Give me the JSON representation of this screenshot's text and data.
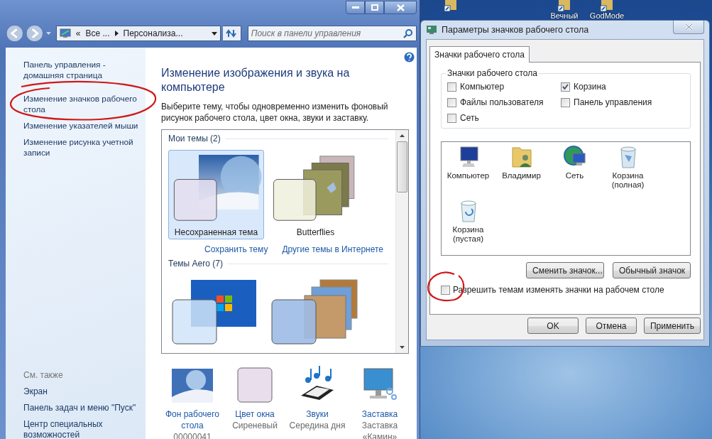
{
  "desktop_icons": [
    {
      "kind": "shortcut"
    },
    {
      "kind": "shortcut",
      "label": "Вечный"
    },
    {
      "kind": "shortcut",
      "label": "GodMode"
    }
  ],
  "control_panel": {
    "address": {
      "overflow": "«",
      "segments": [
        "Все ...",
        "Персонализа..."
      ]
    },
    "search": {
      "placeholder": "Поиск в панели управления"
    },
    "sidebar": {
      "items": [
        "Панель управления - домашняя страница",
        "Изменение значков рабочего стола",
        "Изменение указателей мыши",
        "Изменение рисунка учетной записи"
      ],
      "see_also_title": "См. также",
      "see_also": [
        "Экран",
        "Панель задач и меню \"Пуск\"",
        "Центр специальных возможностей"
      ]
    },
    "heading": "Изменение изображения и звука на компьютере",
    "description": "Выберите тему, чтобы одновременно изменить фоновый рисунок рабочего стола, цвет окна, звуки и заставку.",
    "theme_groups": [
      {
        "title": "Мои темы (2)",
        "themes": [
          {
            "kind": "moon",
            "name": "Несохраненная тема",
            "selected": true
          },
          {
            "kind": "butterflies",
            "name": "Butterflies",
            "selected": false
          }
        ],
        "links": [
          "Сохранить тему",
          "Другие темы в Интернете"
        ]
      },
      {
        "title": "Темы Aero (7)",
        "themes": [
          {
            "kind": "windows7",
            "selected": false
          },
          {
            "kind": "landscapes",
            "selected": false
          }
        ]
      }
    ],
    "settings": [
      {
        "kind": "background",
        "label": "Фон рабочего стола",
        "value": "00000041"
      },
      {
        "kind": "color",
        "label": "Цвет окна",
        "value": "Сиреневый"
      },
      {
        "kind": "sounds",
        "label": "Звуки",
        "value": "Середина дня"
      },
      {
        "kind": "screensaver",
        "label": "Заставка",
        "value": "Заставка «Камин»"
      }
    ]
  },
  "dialog": {
    "title": "Параметры значков рабочего стола",
    "tabs": [
      {
        "label": "Значки рабочего стола",
        "selected": true
      }
    ],
    "group_title": "Значки рабочего стола",
    "checkboxes": [
      {
        "label": "Компьютер",
        "checked": false
      },
      {
        "label": "Корзина",
        "checked": true
      },
      {
        "label": "Файлы пользователя",
        "checked": false
      },
      {
        "label": "Панель управления",
        "checked": false
      },
      {
        "label": "Сеть",
        "checked": false
      }
    ],
    "icons": [
      {
        "kind": "computer",
        "label": "Компьютер"
      },
      {
        "kind": "user",
        "label": "Владимир"
      },
      {
        "kind": "network",
        "label": "Сеть"
      },
      {
        "kind": "bin_full",
        "label": "Корзина (полная)"
      },
      {
        "kind": "bin_empty",
        "label": "Корзина (пустая)"
      }
    ],
    "icon_buttons": [
      "Сменить значок...",
      "Обычный значок"
    ],
    "allow_themes": {
      "label": "Разрешить темам изменять значки на рабочем столе",
      "checked": false
    },
    "buttons": [
      "OK",
      "Отмена",
      "Применить"
    ]
  }
}
